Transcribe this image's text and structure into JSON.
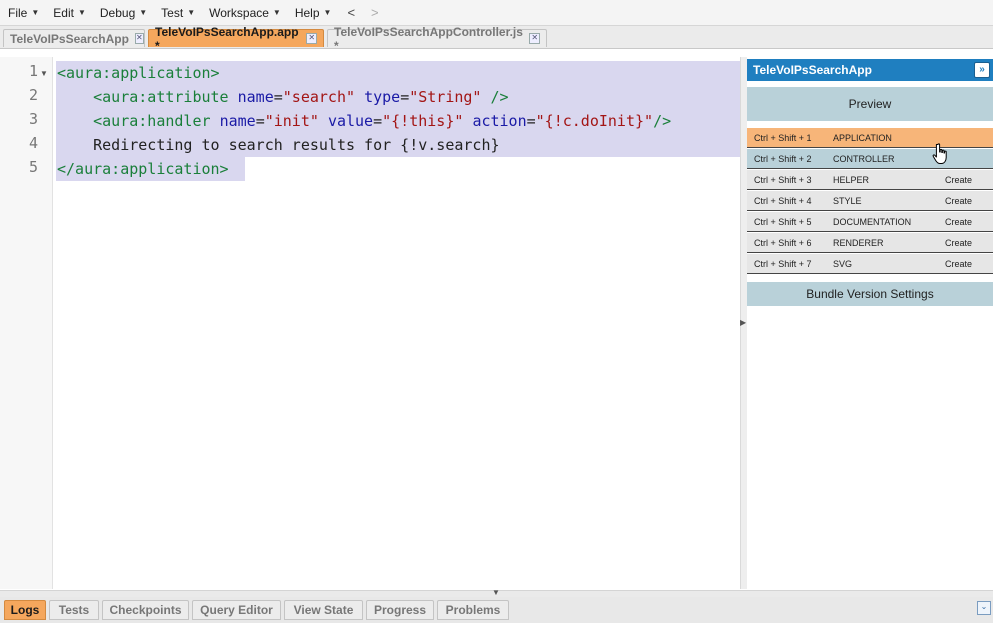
{
  "menu": {
    "items": [
      "File",
      "Edit",
      "Debug",
      "Test",
      "Workspace",
      "Help"
    ],
    "back": "<",
    "forward": ">"
  },
  "tabs": [
    {
      "label": "TeleVoIPsSearchApp",
      "active": false
    },
    {
      "label": "TeleVoIPsSearchApp.app *",
      "active": true
    },
    {
      "label": "TeleVoIPsSearchAppController.js *",
      "active": false
    }
  ],
  "editor": {
    "line_numbers": [
      "1",
      "2",
      "3",
      "4",
      "5"
    ],
    "lines": [
      {
        "tokens": [
          {
            "t": "tag",
            "v": "<aura:application>"
          }
        ]
      },
      {
        "tokens": [
          {
            "t": "plain",
            "v": "    "
          },
          {
            "t": "tag",
            "v": "<aura:attribute "
          },
          {
            "t": "attr",
            "v": "name"
          },
          {
            "t": "plain",
            "v": "="
          },
          {
            "t": "val",
            "v": "\"search\""
          },
          {
            "t": "plain",
            "v": " "
          },
          {
            "t": "attr",
            "v": "type"
          },
          {
            "t": "plain",
            "v": "="
          },
          {
            "t": "val",
            "v": "\"String\""
          },
          {
            "t": "plain",
            "v": " "
          },
          {
            "t": "tag",
            "v": "/>"
          }
        ]
      },
      {
        "tokens": [
          {
            "t": "plain",
            "v": "    "
          },
          {
            "t": "tag",
            "v": "<aura:handler "
          },
          {
            "t": "attr",
            "v": "name"
          },
          {
            "t": "plain",
            "v": "="
          },
          {
            "t": "val",
            "v": "\"init\""
          },
          {
            "t": "plain",
            "v": " "
          },
          {
            "t": "attr",
            "v": "value"
          },
          {
            "t": "plain",
            "v": "="
          },
          {
            "t": "val",
            "v": "\"{!this}\""
          },
          {
            "t": "plain",
            "v": " "
          },
          {
            "t": "attr",
            "v": "action"
          },
          {
            "t": "plain",
            "v": "="
          },
          {
            "t": "val",
            "v": "\"{!c.doInit}\""
          },
          {
            "t": "tag",
            "v": "/>"
          }
        ]
      },
      {
        "tokens": [
          {
            "t": "plain",
            "v": "    Redirecting to search results for {!v.search}"
          }
        ]
      },
      {
        "tokens": [
          {
            "t": "tag",
            "v": "</aura:application>"
          }
        ]
      }
    ]
  },
  "right_panel": {
    "title": "TeleVoIPsSearchApp",
    "collapse_icon": "double-chevron-right-icon",
    "preview_label": "Preview",
    "bundle_items": [
      {
        "shortcut": "Ctrl + Shift + 1",
        "name": "APPLICATION",
        "action": "",
        "state": "active"
      },
      {
        "shortcut": "Ctrl + Shift + 2",
        "name": "CONTROLLER",
        "action": "",
        "state": "existing"
      },
      {
        "shortcut": "Ctrl + Shift + 3",
        "name": "HELPER",
        "action": "Create",
        "state": "new"
      },
      {
        "shortcut": "Ctrl + Shift + 4",
        "name": "STYLE",
        "action": "Create",
        "state": "new"
      },
      {
        "shortcut": "Ctrl + Shift + 5",
        "name": "DOCUMENTATION",
        "action": "Create",
        "state": "new"
      },
      {
        "shortcut": "Ctrl + Shift + 6",
        "name": "RENDERER",
        "action": "Create",
        "state": "new"
      },
      {
        "shortcut": "Ctrl + Shift + 7",
        "name": "SVG",
        "action": "Create",
        "state": "new"
      }
    ],
    "bundle_settings_label": "Bundle Version Settings"
  },
  "bottom_tabs": [
    {
      "label": "Logs",
      "active": true
    },
    {
      "label": "Tests",
      "active": false
    },
    {
      "label": "Checkpoints",
      "active": false
    },
    {
      "label": "Query Editor",
      "active": false
    },
    {
      "label": "View State",
      "active": false
    },
    {
      "label": "Progress",
      "active": false
    },
    {
      "label": "Problems",
      "active": false
    }
  ],
  "colors": {
    "active_tab": "#f5a75d",
    "panel_header": "#1f7fc0",
    "selection": "#d9d7ef",
    "section_bg": "#b9d1d9"
  }
}
